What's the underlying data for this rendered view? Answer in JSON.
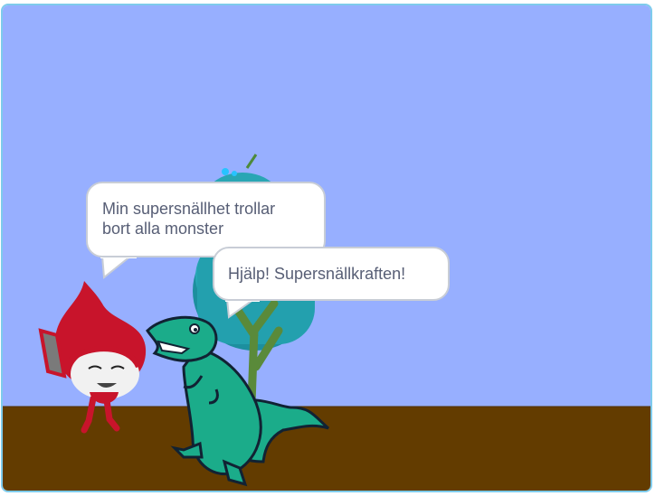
{
  "stage": {
    "sky_color": "#97afff",
    "ground_color": "#633c00",
    "border_color": "#7ecbec"
  },
  "sprites": {
    "pico": {
      "name": "red-flame-character"
    },
    "dinosaur": {
      "name": "green-dinosaur"
    },
    "tree": {
      "name": "teal-tree"
    }
  },
  "speech": {
    "pico_text": "Min supersnällhet trollar\nbort alla monster",
    "dino_text": "Hjälp! Supersnällkraften!"
  }
}
